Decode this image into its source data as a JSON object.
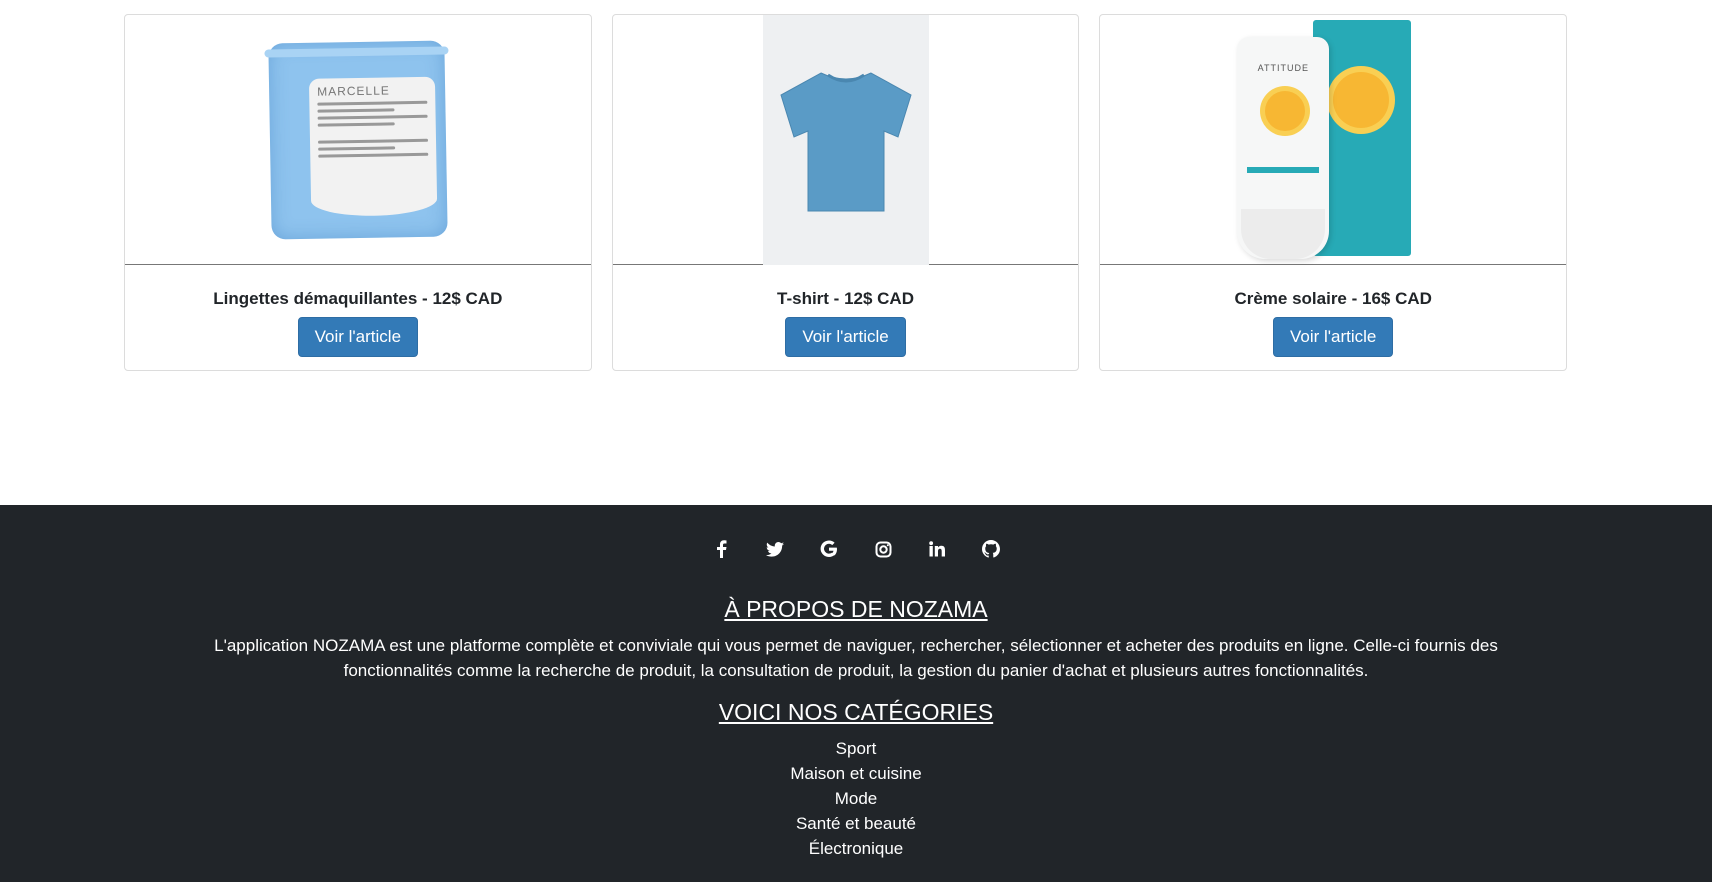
{
  "products": [
    {
      "title": "Lingettes démaquillantes - 12$ CAD",
      "button": "Voir l'article",
      "image": "makeup-wipes-package",
      "brand": "MARCELLE"
    },
    {
      "title": "T-shirt - 12$ CAD",
      "button": "Voir l'article",
      "image": "blue-tshirt"
    },
    {
      "title": "Crème solaire - 16$ CAD",
      "button": "Voir l'article",
      "image": "sunscreen-tube-and-box",
      "brand": "ATTITUDE"
    }
  ],
  "footer": {
    "social": [
      "facebook-icon",
      "twitter-icon",
      "google-icon",
      "instagram-icon",
      "linkedin-icon",
      "github-icon"
    ],
    "about_title": "À PROPOS DE NOZAMA",
    "about_text": "L'application NOZAMA est une platforme complète et conviviale qui vous permet de naviguer, rechercher, sélectionner et acheter des produits en ligne. Celle-ci fournis des fonctionnalités comme la recherche de produit, la consultation de produit, la gestion du panier d'achat et plusieurs autres fonctionnalités.",
    "categories_title": "VOICI NOS CATÉGORIES",
    "categories": [
      "Sport",
      "Maison et cuisine",
      "Mode",
      "Santé et beauté",
      "Électronique"
    ]
  },
  "colors": {
    "button": "#337ab7",
    "footer_bg": "#212529"
  }
}
